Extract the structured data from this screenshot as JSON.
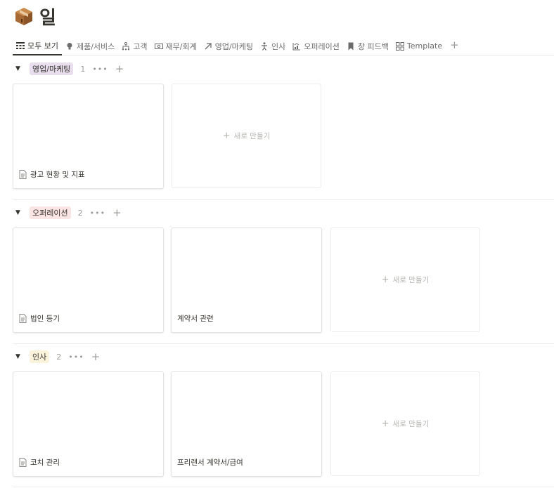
{
  "page": {
    "icon": "package-icon",
    "title": "일"
  },
  "tabs": [
    {
      "label": "모두 보기",
      "icon": "board-icon",
      "active": true
    },
    {
      "label": "제품/서비스",
      "icon": "lightbulb-icon"
    },
    {
      "label": "고객",
      "icon": "hierarchy-icon"
    },
    {
      "label": "재무/회계",
      "icon": "money-icon"
    },
    {
      "label": "영업/마케팅",
      "icon": "arrow-up-right-icon"
    },
    {
      "label": "인사",
      "icon": "person-icon"
    },
    {
      "label": "오퍼레이션",
      "icon": "chart-icon"
    },
    {
      "label": "창 피드백",
      "icon": "bookmark-icon"
    },
    {
      "label": "Template",
      "icon": "gallery-icon"
    }
  ],
  "tab_add": "+",
  "groups": [
    {
      "label": "영업/마케팅",
      "count": "1",
      "color": "#e8deee",
      "cards": [
        {
          "title": "광고 현황 및 지표",
          "icon": true
        }
      ]
    },
    {
      "label": "오퍼레이션",
      "count": "2",
      "color": "#fbe4e4",
      "cards": [
        {
          "title": "법인 등기",
          "icon": true
        },
        {
          "title": "계약서 관련",
          "icon": false
        }
      ]
    },
    {
      "label": "인사",
      "count": "2",
      "color": "#fbf3db",
      "cards": [
        {
          "title": "코치 관리",
          "icon": true
        },
        {
          "title": "프리랜서 계약서/급여",
          "icon": false
        }
      ]
    }
  ],
  "group_more": "•••",
  "group_add": "+",
  "new_card_label": "새로 만들기",
  "new_card_plus": "+"
}
